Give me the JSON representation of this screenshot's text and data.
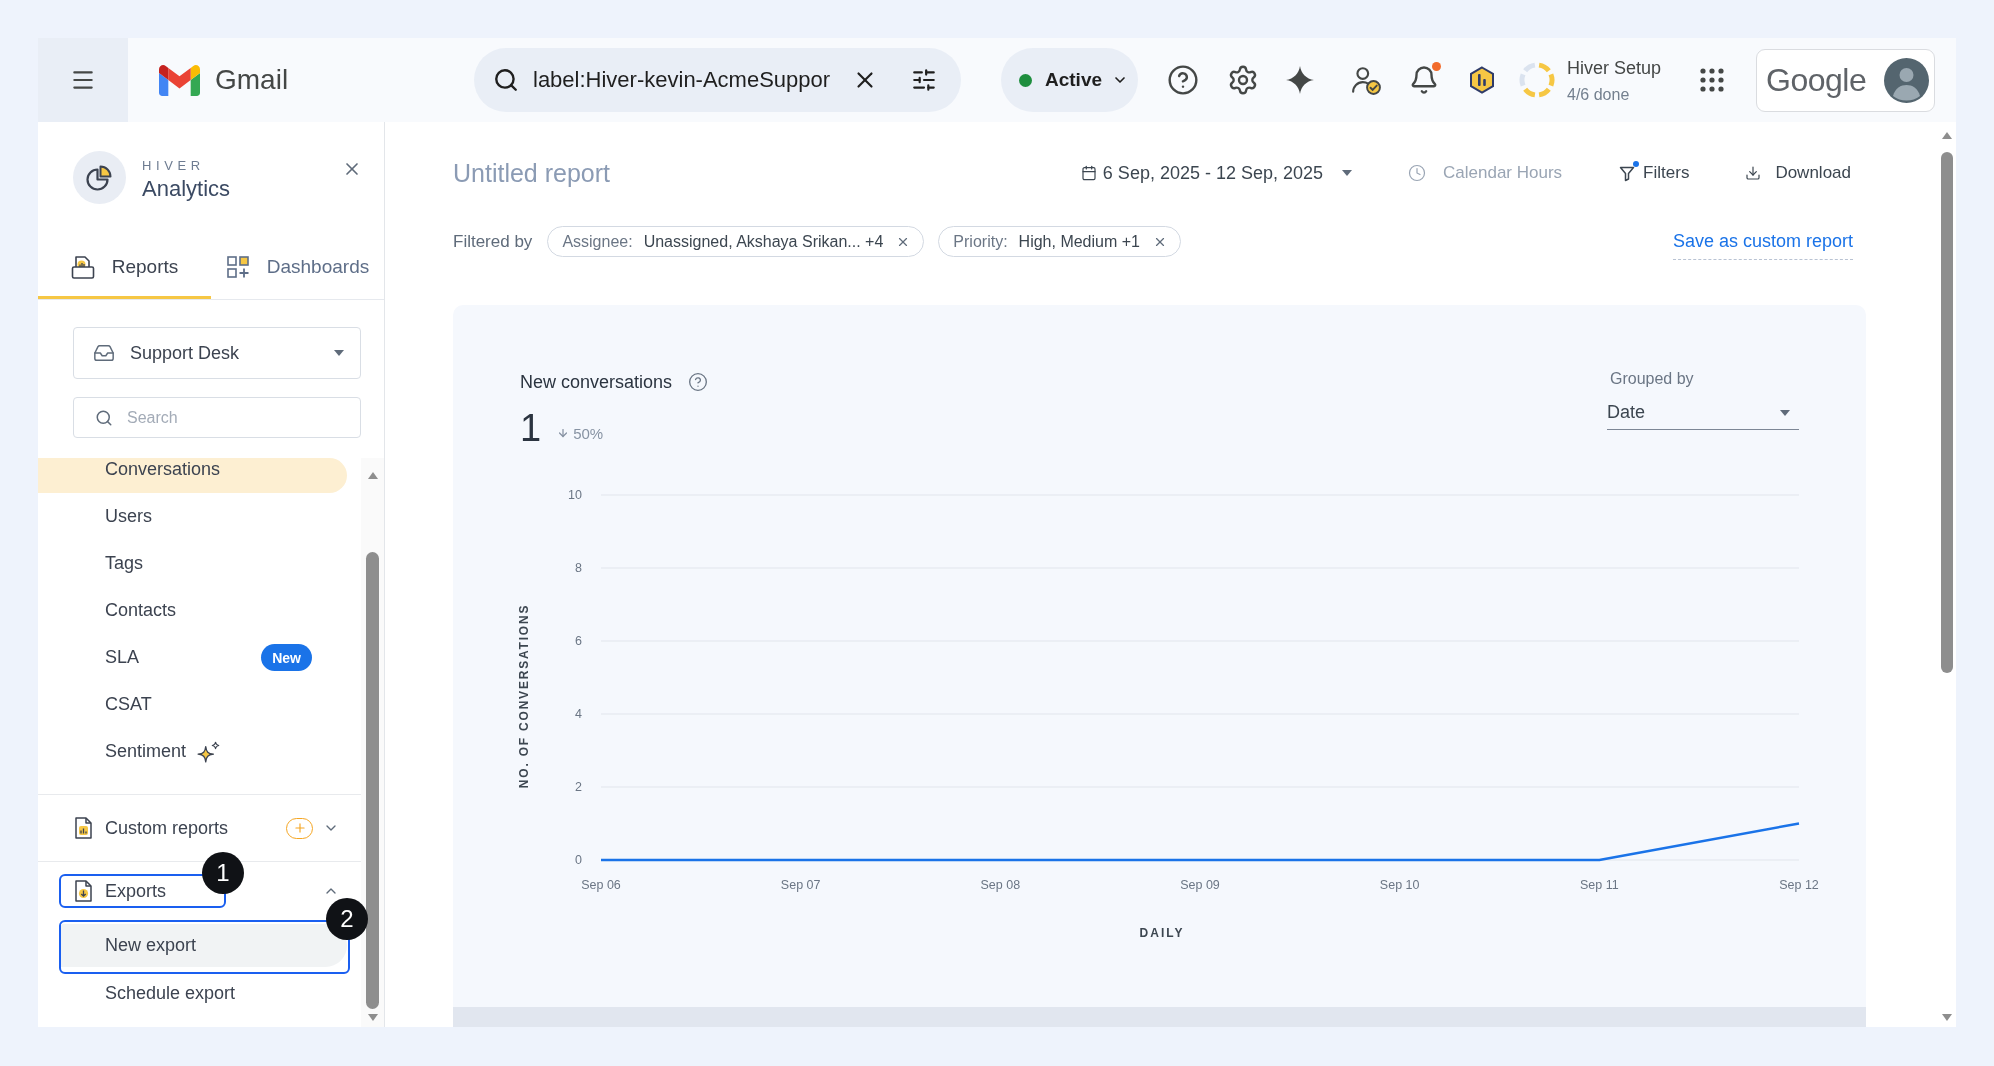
{
  "top_bar": {
    "app_name": "Gmail",
    "search": {
      "value": "label:Hiver-kevin-AcmeSuppor"
    },
    "status": {
      "label": "Active",
      "color": "#1e8e3e"
    },
    "notifications": {
      "unread": true
    },
    "setup": {
      "title": "Hiver Setup",
      "progress": "4/6 done",
      "level": 0.667
    },
    "account": {
      "label": "Google"
    }
  },
  "sidebar": {
    "brand": "HIVER",
    "title": "Analytics",
    "tabs": [
      {
        "label": "Reports",
        "selected": true
      },
      {
        "label": "Dashboards",
        "selected": false
      }
    ],
    "inbox_select": {
      "value": "Support Desk"
    },
    "search": {
      "placeholder": "Search"
    },
    "reports": [
      {
        "label": "Conversations",
        "selected": true,
        "kind": "plain"
      },
      {
        "label": "Users",
        "selected": false,
        "kind": "plain"
      },
      {
        "label": "Tags",
        "selected": false,
        "kind": "plain"
      },
      {
        "label": "Contacts",
        "selected": false,
        "kind": "plain"
      },
      {
        "label": "SLA",
        "selected": false,
        "kind": "badge",
        "badge": "New"
      },
      {
        "label": "CSAT",
        "selected": false,
        "kind": "plain"
      },
      {
        "label": "Sentiment",
        "selected": false,
        "kind": "ai"
      }
    ],
    "sections": [
      {
        "label": "Custom reports",
        "kind": "custom",
        "expanded": false
      },
      {
        "label": "Exports",
        "kind": "exports",
        "expanded": true,
        "callout": "1",
        "items": [
          {
            "label": "New export",
            "selected": true,
            "callout": "2"
          },
          {
            "label": "Schedule export",
            "selected": false
          }
        ]
      }
    ]
  },
  "report": {
    "title": "Untitled report",
    "date_range": "6 Sep, 2025 - 12 Sep, 2025",
    "hours": {
      "label": "Calendar Hours",
      "disabled": true
    },
    "filters": {
      "label": "Filters",
      "active": true
    },
    "download": {
      "label": "Download"
    },
    "filtered_by": "Filtered by",
    "filter_chips": [
      {
        "name": "Assignee:",
        "value": "Unassigned, Akshaya Srikan... +4"
      },
      {
        "name": "Priority:",
        "value": "High, Medium +1"
      }
    ],
    "save_link": "Save as custom report",
    "card": {
      "title": "New conversations",
      "total": "1",
      "change": "50%",
      "grouped_by": {
        "label": "Grouped by",
        "value": "Date"
      },
      "chart_data": {
        "type": "line",
        "xlabel": "DAILY",
        "ylabel": "NO. OF CONVERSATIONS",
        "categories": [
          "Sep 06",
          "Sep 07",
          "Sep 08",
          "Sep 09",
          "Sep 10",
          "Sep 11",
          "Sep 12"
        ],
        "series": [
          {
            "color": "#1a73e8",
            "values": [
              0,
              0,
              0,
              0,
              0,
              0,
              1
            ]
          }
        ],
        "ylim": [
          0,
          10
        ],
        "yticks": [
          0,
          2,
          4,
          6,
          8,
          10
        ],
        "grid": true
      }
    }
  }
}
